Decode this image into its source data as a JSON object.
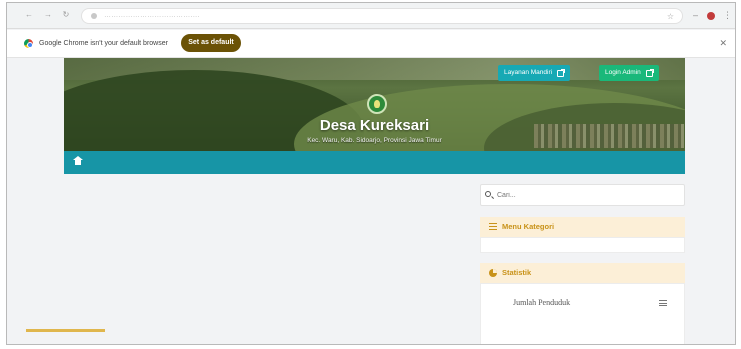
{
  "browser": {
    "url": "………………………………….",
    "infobar_text": "Google Chrome isn't your default browser",
    "set_default_label": "Set as default"
  },
  "header": {
    "buttons": [
      {
        "label": "Layanan Mandiri"
      },
      {
        "label": "Login Admin"
      }
    ],
    "site_title": "Desa Kureksari",
    "site_subtitle": "Kec. Waru, Kab. Sidoarjo, Provinsi Jawa Timur"
  },
  "search": {
    "placeholder": "Cari..."
  },
  "sidebar": {
    "menu_kategori": "Menu Kategori",
    "statistik": "Statistik",
    "jumlah_penduduk": "Jumlah Penduduk"
  },
  "colors": {
    "nav_bar": "#1795a6",
    "accent_gold": "#c89219",
    "teal_button": "#17a9b4",
    "green_button": "#1ab87a",
    "set_default": "#6b5206"
  },
  "icons": [
    "back-icon",
    "forward-icon",
    "reload-icon",
    "chrome-logo-icon",
    "external-link-icon",
    "village-emblem-icon",
    "home-icon",
    "search-icon",
    "list-icon",
    "pie-chart-icon",
    "menu-bars-icon",
    "close-icon"
  ]
}
